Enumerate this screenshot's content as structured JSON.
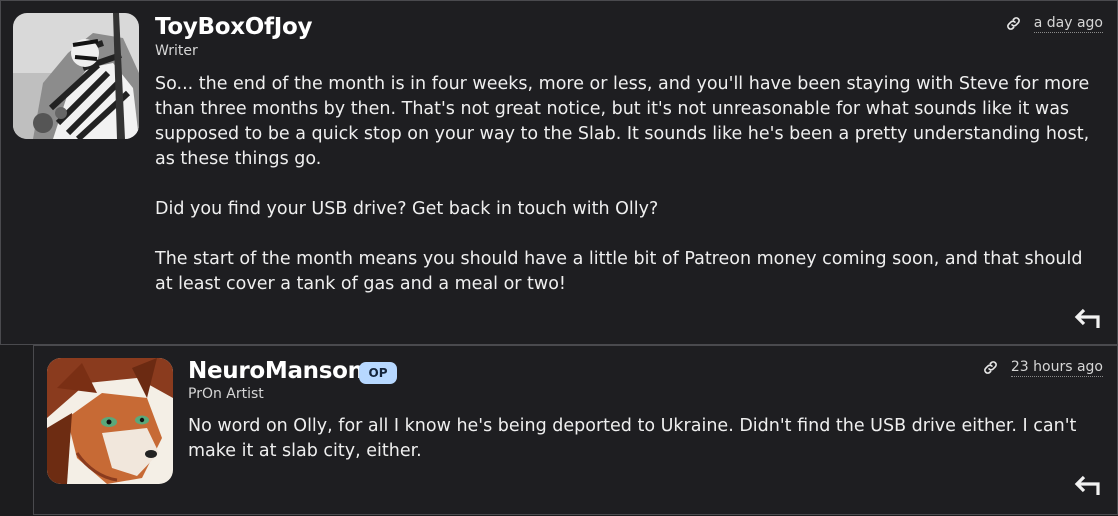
{
  "comments": [
    {
      "author": "ToyBoxOfJoy",
      "role": "Writer",
      "timestamp": "a day ago",
      "avatar_icon": "grayscale-striped-character-avatar",
      "paragraphs": [
        "So... the end of the month is in four weeks, more or less, and you'll have been staying with Steve for more than three months by then. That's not great notice, but it's not unreasonable for what sounds like it was supposed to be a quick stop on your way to the Slab. It sounds like he's been a pretty understanding host, as these things go.",
        "Did you find your USB drive? Get back in touch with Olly?",
        "The start of the month means you should have a little bit of Patreon money coming soon, and that should at least cover a tank of gas and a meal or two!"
      ]
    },
    {
      "author": "NeuroManson",
      "badge": "OP",
      "role": "PrOn Artist",
      "timestamp": "23 hours ago",
      "avatar_icon": "red-fox-character-avatar",
      "paragraphs": [
        "No word on Olly, for all I know he's being deported to Ukraine. Didn't find the USB drive either. I can't make it at slab city, either."
      ]
    }
  ],
  "icons": {
    "permalink": "link-icon",
    "reply": "reply-arrow-icon"
  },
  "colors": {
    "background": "#1e1e21",
    "border": "#4a4a4e",
    "op_badge_bg": "#b7d8ff",
    "op_badge_text": "#14243a"
  }
}
